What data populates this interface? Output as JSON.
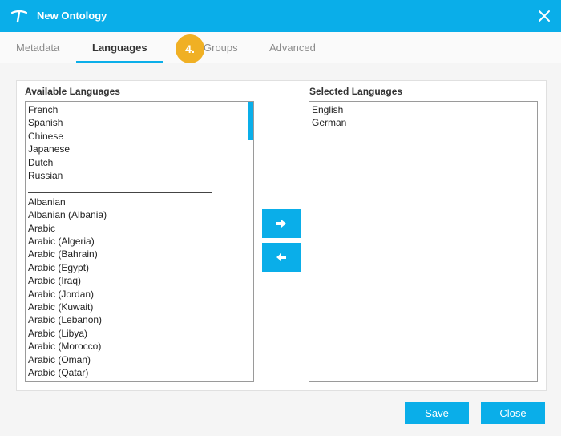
{
  "window": {
    "title": "New Ontology",
    "logo_icon": "t-logo-icon",
    "close_icon": "close-icon"
  },
  "tabs": [
    {
      "label": "Metadata",
      "active": false
    },
    {
      "label": "Languages",
      "active": true
    },
    {
      "label": "Groups",
      "active": false
    },
    {
      "label": "Advanced",
      "active": false
    }
  ],
  "step_badge": "4.",
  "available": {
    "label": "Available Languages",
    "items": [
      "French",
      "Spanish",
      "Chinese",
      "Japanese",
      "Dutch",
      "Russian",
      "",
      "Albanian",
      "Albanian (Albania)",
      "Arabic",
      "Arabic (Algeria)",
      "Arabic (Bahrain)",
      "Arabic (Egypt)",
      "Arabic (Iraq)",
      "Arabic (Jordan)",
      "Arabic (Kuwait)",
      "Arabic (Lebanon)",
      "Arabic (Libya)",
      "Arabic (Morocco)",
      "Arabic (Oman)",
      "Arabic (Qatar)"
    ]
  },
  "selected": {
    "label": "Selected Languages",
    "items": [
      "English",
      "German"
    ]
  },
  "buttons": {
    "add_icon": "arrow-right-icon",
    "remove_icon": "arrow-left-icon",
    "save": "Save",
    "close": "Close"
  },
  "colors": {
    "accent": "#0aaee9",
    "badge": "#f0b024"
  }
}
